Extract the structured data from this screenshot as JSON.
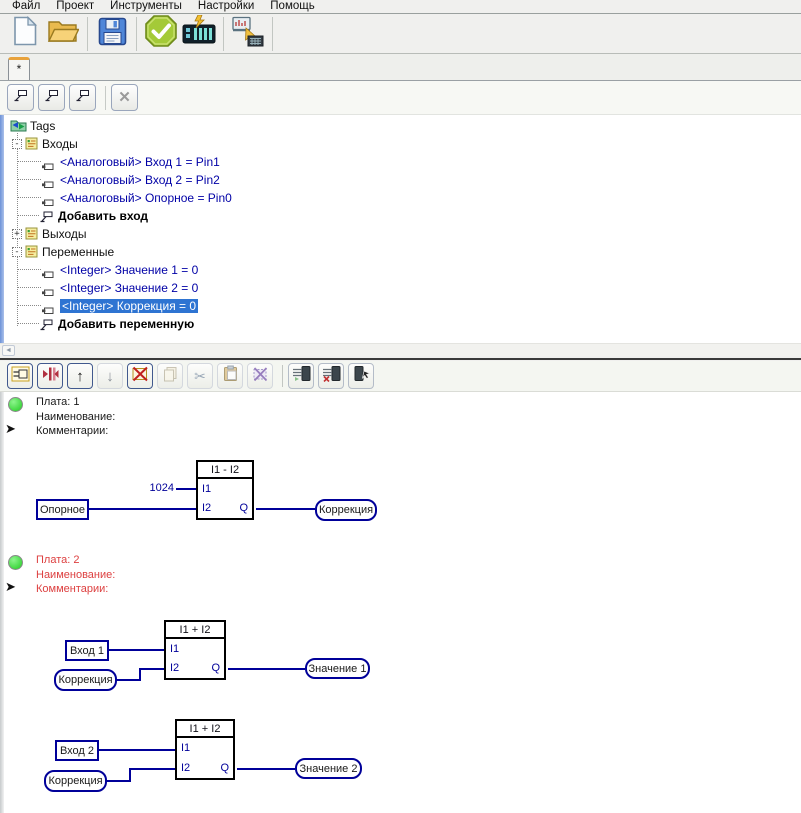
{
  "colors": {
    "selection-bg": "#2e74d2",
    "selection-fg": "#ffffff",
    "tree-item-fg": "#0000a6",
    "wire": "#000099",
    "board-red": "#dd4040",
    "status-green": "#22cc22",
    "tab-accent": "#e8a23c"
  },
  "menubar": {
    "items": [
      "Файл",
      "Проект",
      "Инструменты",
      "Настройки",
      "Помощь"
    ]
  },
  "tabs": {
    "active_label": "*"
  },
  "glyphs": {
    "up": "↑",
    "down": "↓",
    "close": "✕",
    "scissors": "✂",
    "scroll-left": "◄",
    "expand-arrow": "➤",
    "minus": "-",
    "plus": "+"
  },
  "tree": {
    "root_label": "Tags",
    "groups": {
      "inputs_label": "Входы",
      "outputs_label": "Выходы",
      "vars_label": "Переменные"
    },
    "items": {
      "input1": "<Аналоговый> Вход 1 = Pin1",
      "input2": "<Аналоговый> Вход 2 = Pin2",
      "input3": "<Аналоговый> Опорное = Pin0",
      "add_input": "Добавить вход",
      "var1": "<Integer> Значение 1 = 0",
      "var2": "<Integer> Значение 2 = 0",
      "var3": "<Integer> Коррекция = 0",
      "add_var": "Добавить переменную"
    }
  },
  "boards": [
    {
      "board_label": "Плата: 1",
      "name_label": "Наименование:",
      "comments_label": "Комментарии:"
    },
    {
      "board_label": "Плата: 2",
      "name_label": "Наименование:",
      "comments_label": "Комментарии:"
    }
  ],
  "diagrams": [
    {
      "block_title": "I1 - I2",
      "pin_i1": "I1",
      "pin_i2": "I2",
      "pin_q": "Q",
      "i1_value": "1024",
      "i2_tag": "Опорное",
      "q_tag": "Коррекция"
    },
    {
      "block_title": "I1 + I2",
      "pin_i1": "I1",
      "pin_i2": "I2",
      "pin_q": "Q",
      "i1_tag": "Вход 1",
      "i2_tag": "Коррекция",
      "q_tag": "Значение 1"
    },
    {
      "block_title": "I1 + I2",
      "pin_i1": "I1",
      "pin_i2": "I2",
      "pin_q": "Q",
      "i1_tag": "Вход 2",
      "i2_tag": "Коррекция",
      "q_tag": "Значение 2"
    }
  ]
}
